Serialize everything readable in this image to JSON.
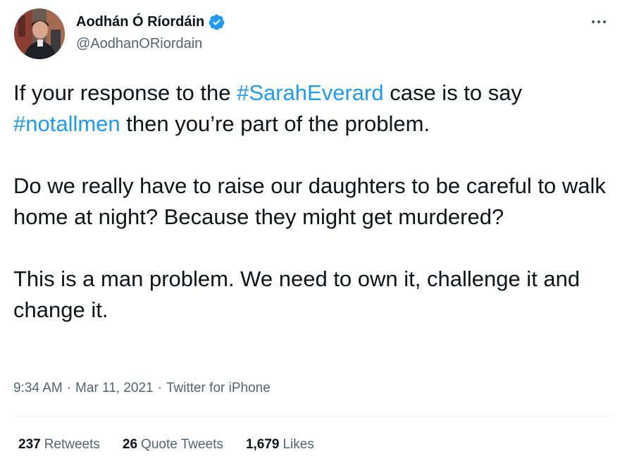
{
  "author": {
    "display_name": "Aodhán Ó Ríordáin",
    "handle": "@AodhanORiordain",
    "verified": true,
    "verified_color": "#1d9bf0"
  },
  "menu": {
    "more_icon": "more-horizontal-icon"
  },
  "tweet": {
    "paragraphs": [
      {
        "segments": [
          {
            "text": "If your response to the ",
            "type": "text"
          },
          {
            "text": "#SarahEverard",
            "type": "hashtag"
          },
          {
            "text": " case is to say ",
            "type": "text"
          },
          {
            "text": "#notallmen",
            "type": "hashtag"
          },
          {
            "text": " then you’re part of the problem.",
            "type": "text"
          }
        ]
      },
      {
        "segments": [
          {
            "text": "Do we really have to raise our daughters to be careful to walk home at night? Because they might get murdered?",
            "type": "text"
          }
        ]
      },
      {
        "segments": [
          {
            "text": "This is a man problem. We need to own it, challenge it and change it.",
            "type": "text"
          }
        ]
      }
    ]
  },
  "meta": {
    "time": "9:34 AM",
    "sep1": "·",
    "date": "Mar 11, 2021",
    "sep2": "·",
    "source": "Twitter for iPhone"
  },
  "stats": {
    "retweets_count": "237",
    "retweets_label": "Retweets",
    "quotes_count": "26",
    "quotes_label": "Quote Tweets",
    "likes_count": "1,679",
    "likes_label": "Likes"
  },
  "colors": {
    "text_primary": "#0f1419",
    "text_secondary": "#536471",
    "link": "#1d9bf0",
    "divider": "#eff3f4"
  }
}
